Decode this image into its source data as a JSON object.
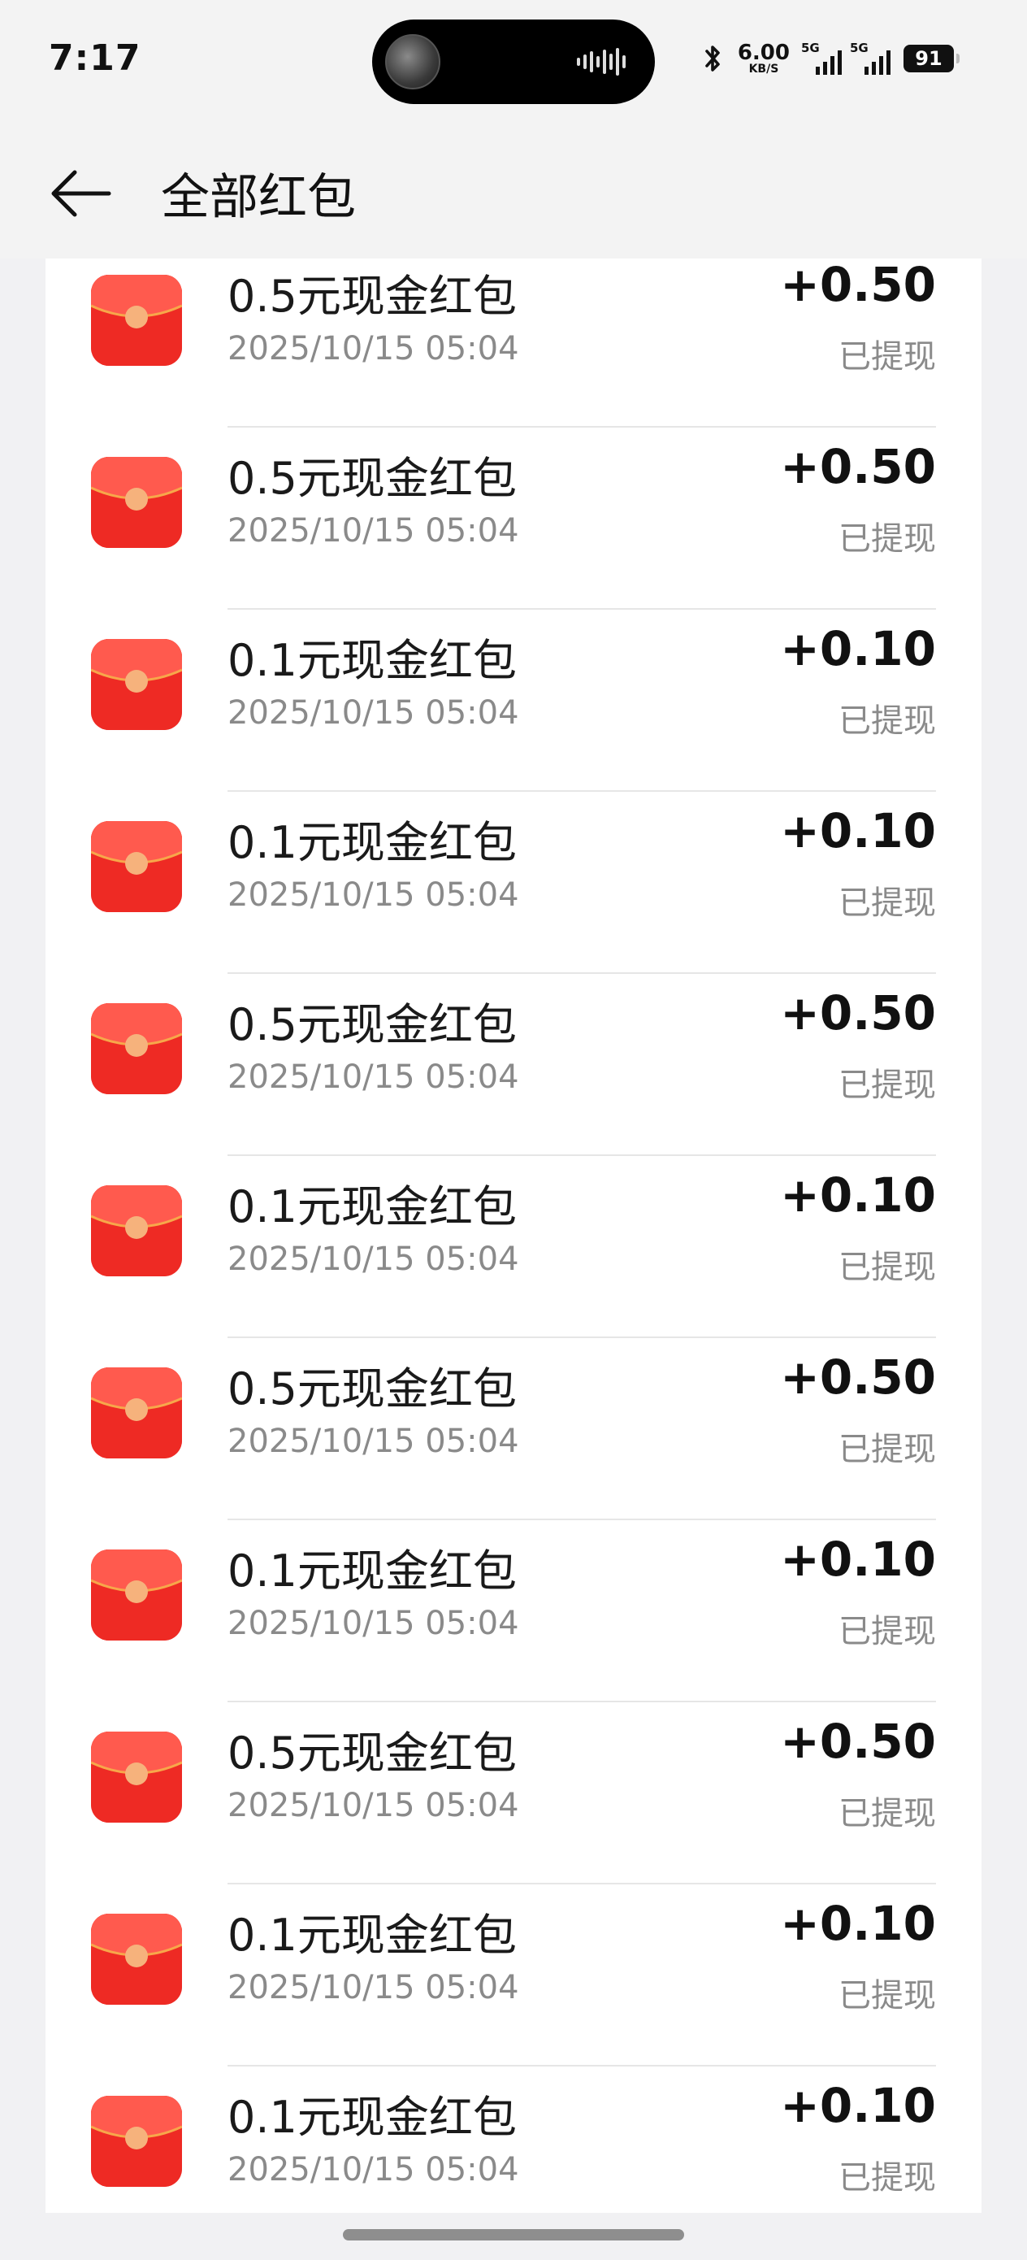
{
  "status_bar": {
    "time": "7:17",
    "net_speed_value": "6.00",
    "net_speed_unit": "KB/S",
    "sim1_label": "5G",
    "sim2_label": "5G",
    "battery": "91"
  },
  "header": {
    "title": "全部红包"
  },
  "colors": {
    "packet_red": "#ee2a24",
    "packet_flap": "#ff5a4e",
    "packet_clasp": "#f6b27c"
  },
  "items": [
    {
      "title": "0.5元现金红包",
      "time": "2025/10/15 05:04",
      "amount": "+0.50",
      "status": "已提现"
    },
    {
      "title": "0.5元现金红包",
      "time": "2025/10/15 05:04",
      "amount": "+0.50",
      "status": "已提现"
    },
    {
      "title": "0.1元现金红包",
      "time": "2025/10/15 05:04",
      "amount": "+0.10",
      "status": "已提现"
    },
    {
      "title": "0.1元现金红包",
      "time": "2025/10/15 05:04",
      "amount": "+0.10",
      "status": "已提现"
    },
    {
      "title": "0.5元现金红包",
      "time": "2025/10/15 05:04",
      "amount": "+0.50",
      "status": "已提现"
    },
    {
      "title": "0.1元现金红包",
      "time": "2025/10/15 05:04",
      "amount": "+0.10",
      "status": "已提现"
    },
    {
      "title": "0.5元现金红包",
      "time": "2025/10/15 05:04",
      "amount": "+0.50",
      "status": "已提现"
    },
    {
      "title": "0.1元现金红包",
      "time": "2025/10/15 05:04",
      "amount": "+0.10",
      "status": "已提现"
    },
    {
      "title": "0.5元现金红包",
      "time": "2025/10/15 05:04",
      "amount": "+0.50",
      "status": "已提现"
    },
    {
      "title": "0.1元现金红包",
      "time": "2025/10/15 05:04",
      "amount": "+0.10",
      "status": "已提现"
    },
    {
      "title": "0.1元现金红包",
      "time": "2025/10/15 05:04",
      "amount": "+0.10",
      "status": "已提现"
    }
  ]
}
